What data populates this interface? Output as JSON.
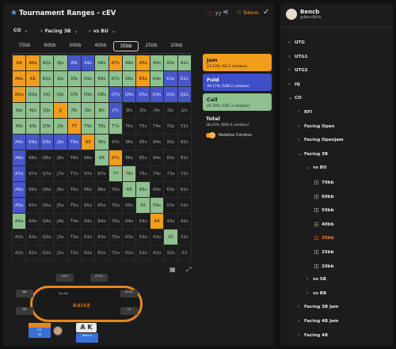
{
  "header": {
    "title": "Tournament Ranges - cEV",
    "likes": "77",
    "tokens_label": "Tokens"
  },
  "selectors": [
    {
      "label": "CO"
    },
    {
      "label": "Facing 3B"
    },
    {
      "label": "vs BU"
    }
  ],
  "stack_tabs": [
    "75bb",
    "60bb",
    "50bb",
    "40bb",
    "30bb",
    "25bb",
    "20bb"
  ],
  "active_tab": "35bb",
  "grid": {
    "rows": [
      [
        [
          "AA",
          "j"
        ],
        [
          "AKs",
          "j"
        ],
        [
          "AQs",
          "r"
        ],
        [
          "AJs",
          "r"
        ],
        [
          "ATs",
          "f"
        ],
        [
          "A9s",
          "f"
        ],
        [
          "A8s",
          "r"
        ],
        [
          "A7s",
          "j"
        ],
        [
          "A6s",
          "r"
        ],
        [
          "A5s",
          "j"
        ],
        [
          "A4s",
          "r"
        ],
        [
          "A3s",
          "r"
        ],
        [
          "A2s",
          "r"
        ]
      ],
      [
        [
          "AKo",
          "j"
        ],
        [
          "KK",
          "j"
        ],
        [
          "KQs",
          "r"
        ],
        [
          "KJs",
          "r"
        ],
        [
          "KTs",
          "r"
        ],
        [
          "K9s",
          "r"
        ],
        [
          "K8s",
          "r"
        ],
        [
          "K7s",
          "r"
        ],
        [
          "K6s",
          "r"
        ],
        [
          "K5s",
          "j"
        ],
        [
          "K4s",
          "r"
        ],
        [
          "K3s",
          "f"
        ],
        [
          "K2s",
          "f"
        ]
      ],
      [
        [
          "AQo",
          "j"
        ],
        [
          "KQo",
          "r"
        ],
        [
          "QQ",
          "r"
        ],
        [
          "QJs",
          "r"
        ],
        [
          "QTs",
          "r"
        ],
        [
          "Q9s",
          "r"
        ],
        [
          "Q8s",
          "r"
        ],
        [
          "Q7s",
          "f"
        ],
        [
          "Q6s",
          "f"
        ],
        [
          "Q5s",
          "f"
        ],
        [
          "Q4s",
          "f"
        ],
        [
          "Q3s",
          "f"
        ],
        [
          "Q2s",
          "f"
        ]
      ],
      [
        [
          "AJo",
          "r"
        ],
        [
          "KJo",
          "r"
        ],
        [
          "QJo",
          "r"
        ],
        [
          "JJ",
          "j"
        ],
        [
          "JTs",
          "r"
        ],
        [
          "J9s",
          "r"
        ],
        [
          "J8s",
          "r"
        ],
        [
          "J7s",
          "f"
        ],
        [
          "J6s",
          "x"
        ],
        [
          "J5s",
          "x"
        ],
        [
          "J4s",
          "x"
        ],
        [
          "J3s",
          "x"
        ],
        [
          "J2s",
          "x"
        ]
      ],
      [
        [
          "ATo",
          "r"
        ],
        [
          "KTo",
          "r"
        ],
        [
          "QTo",
          "r"
        ],
        [
          "JTo",
          "r"
        ],
        [
          "TT",
          "j"
        ],
        [
          "T9s",
          "r"
        ],
        [
          "T8s",
          "r"
        ],
        [
          "T7s",
          "r"
        ],
        [
          "T6s",
          "x"
        ],
        [
          "T5s",
          "x"
        ],
        [
          "T4s",
          "x"
        ],
        [
          "T3s",
          "x"
        ],
        [
          "T2s",
          "x"
        ]
      ],
      [
        [
          "A9o",
          "f"
        ],
        [
          "K9o",
          "f"
        ],
        [
          "Q9o",
          "f"
        ],
        [
          "J9o",
          "f"
        ],
        [
          "T9o",
          "f"
        ],
        [
          "99",
          "j"
        ],
        [
          "98s",
          "r"
        ],
        [
          "97s",
          "x"
        ],
        [
          "96s",
          "x"
        ],
        [
          "95s",
          "x"
        ],
        [
          "94s",
          "x"
        ],
        [
          "93s",
          "x"
        ],
        [
          "92s",
          "x"
        ]
      ],
      [
        [
          "A8o",
          "f"
        ],
        [
          "K8o",
          "x"
        ],
        [
          "Q8o",
          "x"
        ],
        [
          "J8o",
          "x"
        ],
        [
          "T8o",
          "x"
        ],
        [
          "98o",
          "x"
        ],
        [
          "88",
          "r"
        ],
        [
          "87s",
          "j"
        ],
        [
          "86s",
          "x"
        ],
        [
          "85s",
          "x"
        ],
        [
          "84s",
          "x"
        ],
        [
          "83s",
          "x"
        ],
        [
          "82s",
          "x"
        ]
      ],
      [
        [
          "A7o",
          "f"
        ],
        [
          "K7o",
          "x"
        ],
        [
          "Q7o",
          "x"
        ],
        [
          "J7o",
          "x"
        ],
        [
          "T7o",
          "x"
        ],
        [
          "97o",
          "x"
        ],
        [
          "87o",
          "x"
        ],
        [
          "77",
          "r"
        ],
        [
          "76s",
          "r"
        ],
        [
          "75s",
          "x"
        ],
        [
          "74s",
          "x"
        ],
        [
          "73s",
          "x"
        ],
        [
          "72s",
          "x"
        ]
      ],
      [
        [
          "A6o",
          "f"
        ],
        [
          "K6o",
          "x"
        ],
        [
          "Q6o",
          "x"
        ],
        [
          "J6o",
          "x"
        ],
        [
          "T6o",
          "x"
        ],
        [
          "96o",
          "x"
        ],
        [
          "86o",
          "x"
        ],
        [
          "76o",
          "x"
        ],
        [
          "66",
          "r"
        ],
        [
          "65s",
          "r"
        ],
        [
          "64s",
          "x"
        ],
        [
          "63s",
          "x"
        ],
        [
          "62s",
          "x"
        ]
      ],
      [
        [
          "A5o",
          "f"
        ],
        [
          "K5o",
          "x"
        ],
        [
          "Q5o",
          "x"
        ],
        [
          "J5o",
          "x"
        ],
        [
          "T5o",
          "x"
        ],
        [
          "95o",
          "x"
        ],
        [
          "85o",
          "x"
        ],
        [
          "75o",
          "x"
        ],
        [
          "65o",
          "x"
        ],
        [
          "55",
          "r"
        ],
        [
          "54s",
          "r"
        ],
        [
          "53s",
          "x"
        ],
        [
          "52s",
          "x"
        ]
      ],
      [
        [
          "A4o",
          "r"
        ],
        [
          "K4o",
          "x"
        ],
        [
          "Q4o",
          "x"
        ],
        [
          "J4o",
          "x"
        ],
        [
          "T4o",
          "x"
        ],
        [
          "94o",
          "x"
        ],
        [
          "84o",
          "x"
        ],
        [
          "74o",
          "x"
        ],
        [
          "64o",
          "x"
        ],
        [
          "54o",
          "x"
        ],
        [
          "44",
          "j"
        ],
        [
          "43s",
          "x"
        ],
        [
          "42s",
          "x"
        ]
      ],
      [
        [
          "A3o",
          "x"
        ],
        [
          "K3o",
          "x"
        ],
        [
          "Q3o",
          "x"
        ],
        [
          "J3o",
          "x"
        ],
        [
          "T3o",
          "x"
        ],
        [
          "93o",
          "x"
        ],
        [
          "83o",
          "x"
        ],
        [
          "73o",
          "x"
        ],
        [
          "63o",
          "x"
        ],
        [
          "53o",
          "x"
        ],
        [
          "43o",
          "x"
        ],
        [
          "33",
          "r"
        ],
        [
          "32s",
          "x"
        ]
      ],
      [
        [
          "A2o",
          "x"
        ],
        [
          "K2o",
          "x"
        ],
        [
          "Q2o",
          "x"
        ],
        [
          "J2o",
          "x"
        ],
        [
          "T2o",
          "x"
        ],
        [
          "92o",
          "x"
        ],
        [
          "82o",
          "x"
        ],
        [
          "72o",
          "x"
        ],
        [
          "62o",
          "x"
        ],
        [
          "52o",
          "x"
        ],
        [
          "42o",
          "x"
        ],
        [
          "32o",
          "x"
        ],
        [
          "22",
          "x"
        ]
      ]
    ]
  },
  "legend": {
    "jam": {
      "title": "Jam",
      "sub": "23.13% (64.3 combos)"
    },
    "fold": {
      "title": "Fold",
      "sub": "39.17% (168.2 combos)"
    },
    "call": {
      "title": "Call",
      "sub": "40.70% (195.3 combos)"
    },
    "total": {
      "title": "Total",
      "sub": "38.25% (660.4 combos)"
    },
    "toggle_label": "Relative Combos"
  },
  "table": {
    "logo": "RAISE",
    "seats": [
      "UTG",
      "UTG1",
      "UTG2",
      "HJ",
      "BB",
      "SB"
    ],
    "hero": {
      "position": "CO",
      "stack": "35",
      "cards": [
        "A",
        "K"
      ],
      "name": "Bench"
    },
    "villain": "You Me"
  },
  "user": {
    "name": "Bencb",
    "handle": "@BencB/Hil"
  },
  "tree": [
    {
      "label": "UTG",
      "indent": 0,
      "chev": "›"
    },
    {
      "label": "UTG1",
      "indent": 0,
      "chev": "›"
    },
    {
      "label": "UTG2",
      "indent": 0,
      "chev": "›"
    },
    {
      "label": "HJ",
      "indent": 0,
      "chev": "›"
    },
    {
      "label": "CO",
      "indent": 0,
      "chev": "⌄"
    },
    {
      "label": "RFI",
      "indent": 1,
      "chev": "›"
    },
    {
      "label": "Facing Open",
      "indent": 1,
      "chev": "›"
    },
    {
      "label": "Facing Openjam",
      "indent": 1,
      "chev": "›"
    },
    {
      "label": "Facing 3B",
      "indent": 1,
      "chev": "⌄"
    },
    {
      "label": "vs BU",
      "indent": 2,
      "chev": "⌄"
    },
    {
      "label": "70bb",
      "indent": 3,
      "grid": true
    },
    {
      "label": "60bb",
      "indent": 3,
      "grid": true
    },
    {
      "label": "50bb",
      "indent": 3,
      "grid": true
    },
    {
      "label": "40bb",
      "indent": 3,
      "grid": true
    },
    {
      "label": "35bb",
      "indent": 3,
      "grid": true,
      "active": true
    },
    {
      "label": "25bb",
      "indent": 3,
      "grid": true
    },
    {
      "label": "20bb",
      "indent": 3,
      "grid": true
    },
    {
      "label": "vs SB",
      "indent": 2,
      "chev": "›"
    },
    {
      "label": "vs BB",
      "indent": 2,
      "chev": "›"
    },
    {
      "label": "Facing 3B Jam",
      "indent": 1,
      "chev": "›"
    },
    {
      "label": "Facing 4B Jam",
      "indent": 1,
      "chev": "›"
    },
    {
      "label": "Facing 4B",
      "indent": 1,
      "chev": "›"
    },
    {
      "label": "BU",
      "indent": 0,
      "chev": "›"
    }
  ]
}
